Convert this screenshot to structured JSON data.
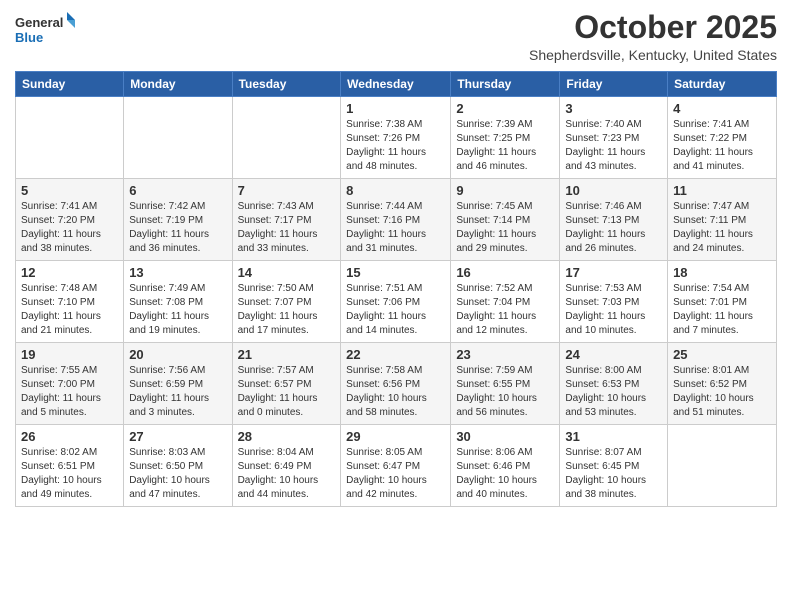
{
  "header": {
    "logo_line1": "General",
    "logo_line2": "Blue",
    "month": "October 2025",
    "location": "Shepherdsville, Kentucky, United States"
  },
  "weekdays": [
    "Sunday",
    "Monday",
    "Tuesday",
    "Wednesday",
    "Thursday",
    "Friday",
    "Saturday"
  ],
  "weeks": [
    [
      {
        "day": "",
        "info": ""
      },
      {
        "day": "",
        "info": ""
      },
      {
        "day": "",
        "info": ""
      },
      {
        "day": "1",
        "info": "Sunrise: 7:38 AM\nSunset: 7:26 PM\nDaylight: 11 hours\nand 48 minutes."
      },
      {
        "day": "2",
        "info": "Sunrise: 7:39 AM\nSunset: 7:25 PM\nDaylight: 11 hours\nand 46 minutes."
      },
      {
        "day": "3",
        "info": "Sunrise: 7:40 AM\nSunset: 7:23 PM\nDaylight: 11 hours\nand 43 minutes."
      },
      {
        "day": "4",
        "info": "Sunrise: 7:41 AM\nSunset: 7:22 PM\nDaylight: 11 hours\nand 41 minutes."
      }
    ],
    [
      {
        "day": "5",
        "info": "Sunrise: 7:41 AM\nSunset: 7:20 PM\nDaylight: 11 hours\nand 38 minutes."
      },
      {
        "day": "6",
        "info": "Sunrise: 7:42 AM\nSunset: 7:19 PM\nDaylight: 11 hours\nand 36 minutes."
      },
      {
        "day": "7",
        "info": "Sunrise: 7:43 AM\nSunset: 7:17 PM\nDaylight: 11 hours\nand 33 minutes."
      },
      {
        "day": "8",
        "info": "Sunrise: 7:44 AM\nSunset: 7:16 PM\nDaylight: 11 hours\nand 31 minutes."
      },
      {
        "day": "9",
        "info": "Sunrise: 7:45 AM\nSunset: 7:14 PM\nDaylight: 11 hours\nand 29 minutes."
      },
      {
        "day": "10",
        "info": "Sunrise: 7:46 AM\nSunset: 7:13 PM\nDaylight: 11 hours\nand 26 minutes."
      },
      {
        "day": "11",
        "info": "Sunrise: 7:47 AM\nSunset: 7:11 PM\nDaylight: 11 hours\nand 24 minutes."
      }
    ],
    [
      {
        "day": "12",
        "info": "Sunrise: 7:48 AM\nSunset: 7:10 PM\nDaylight: 11 hours\nand 21 minutes."
      },
      {
        "day": "13",
        "info": "Sunrise: 7:49 AM\nSunset: 7:08 PM\nDaylight: 11 hours\nand 19 minutes."
      },
      {
        "day": "14",
        "info": "Sunrise: 7:50 AM\nSunset: 7:07 PM\nDaylight: 11 hours\nand 17 minutes."
      },
      {
        "day": "15",
        "info": "Sunrise: 7:51 AM\nSunset: 7:06 PM\nDaylight: 11 hours\nand 14 minutes."
      },
      {
        "day": "16",
        "info": "Sunrise: 7:52 AM\nSunset: 7:04 PM\nDaylight: 11 hours\nand 12 minutes."
      },
      {
        "day": "17",
        "info": "Sunrise: 7:53 AM\nSunset: 7:03 PM\nDaylight: 11 hours\nand 10 minutes."
      },
      {
        "day": "18",
        "info": "Sunrise: 7:54 AM\nSunset: 7:01 PM\nDaylight: 11 hours\nand 7 minutes."
      }
    ],
    [
      {
        "day": "19",
        "info": "Sunrise: 7:55 AM\nSunset: 7:00 PM\nDaylight: 11 hours\nand 5 minutes."
      },
      {
        "day": "20",
        "info": "Sunrise: 7:56 AM\nSunset: 6:59 PM\nDaylight: 11 hours\nand 3 minutes."
      },
      {
        "day": "21",
        "info": "Sunrise: 7:57 AM\nSunset: 6:57 PM\nDaylight: 11 hours\nand 0 minutes."
      },
      {
        "day": "22",
        "info": "Sunrise: 7:58 AM\nSunset: 6:56 PM\nDaylight: 10 hours\nand 58 minutes."
      },
      {
        "day": "23",
        "info": "Sunrise: 7:59 AM\nSunset: 6:55 PM\nDaylight: 10 hours\nand 56 minutes."
      },
      {
        "day": "24",
        "info": "Sunrise: 8:00 AM\nSunset: 6:53 PM\nDaylight: 10 hours\nand 53 minutes."
      },
      {
        "day": "25",
        "info": "Sunrise: 8:01 AM\nSunset: 6:52 PM\nDaylight: 10 hours\nand 51 minutes."
      }
    ],
    [
      {
        "day": "26",
        "info": "Sunrise: 8:02 AM\nSunset: 6:51 PM\nDaylight: 10 hours\nand 49 minutes."
      },
      {
        "day": "27",
        "info": "Sunrise: 8:03 AM\nSunset: 6:50 PM\nDaylight: 10 hours\nand 47 minutes."
      },
      {
        "day": "28",
        "info": "Sunrise: 8:04 AM\nSunset: 6:49 PM\nDaylight: 10 hours\nand 44 minutes."
      },
      {
        "day": "29",
        "info": "Sunrise: 8:05 AM\nSunset: 6:47 PM\nDaylight: 10 hours\nand 42 minutes."
      },
      {
        "day": "30",
        "info": "Sunrise: 8:06 AM\nSunset: 6:46 PM\nDaylight: 10 hours\nand 40 minutes."
      },
      {
        "day": "31",
        "info": "Sunrise: 8:07 AM\nSunset: 6:45 PM\nDaylight: 10 hours\nand 38 minutes."
      },
      {
        "day": "",
        "info": ""
      }
    ]
  ]
}
